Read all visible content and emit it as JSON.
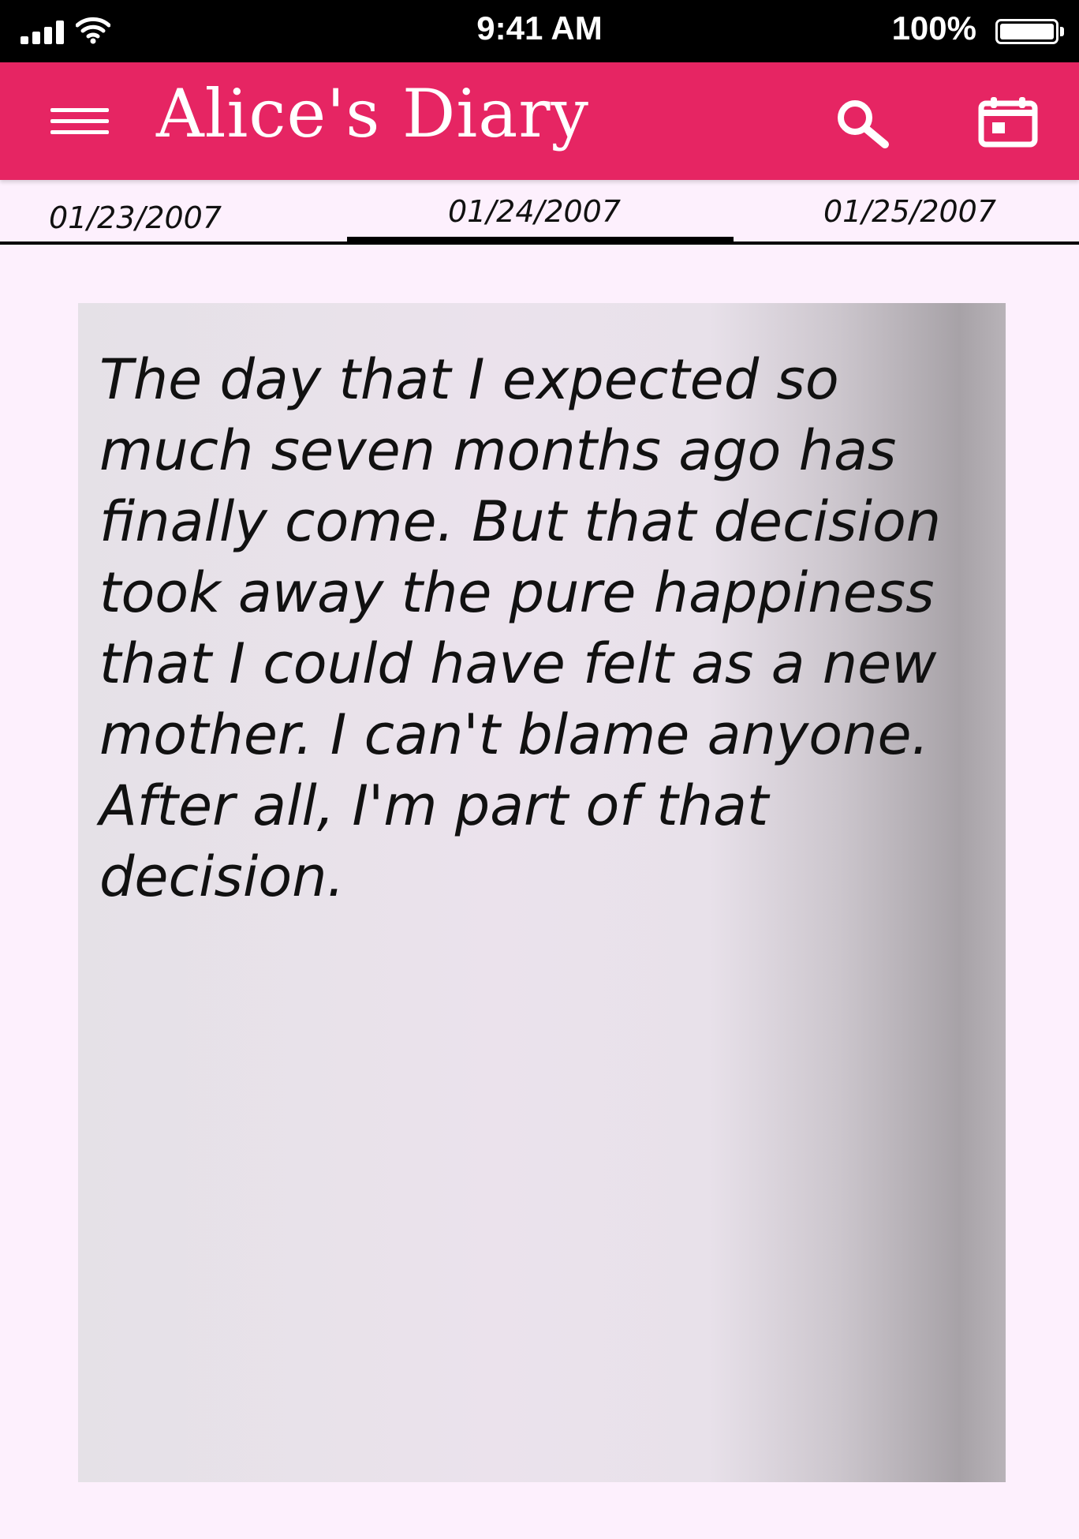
{
  "status_bar": {
    "time": "9:41 AM",
    "battery_percent": "100%",
    "battery_level": 1.0,
    "icons": [
      "signal-icon",
      "wifi-icon",
      "battery-icon"
    ]
  },
  "app_bar": {
    "title": "Alice's Diary",
    "background_color": "#e62563",
    "icons": [
      "menu-icon",
      "search-icon",
      "calendar-icon"
    ]
  },
  "date_tabs": {
    "previous": "01/23/2007",
    "current": "01/24/2007",
    "next": "01/25/2007"
  },
  "entry": {
    "lines": [
      "The day that I expected so",
      "much seven months ago has",
      "finally come. But that decision",
      "took away the pure happiness",
      "that I could have felt as a new",
      "mother. I can't blame anyone.",
      "After all, I'm part of that",
      "decision."
    ]
  }
}
